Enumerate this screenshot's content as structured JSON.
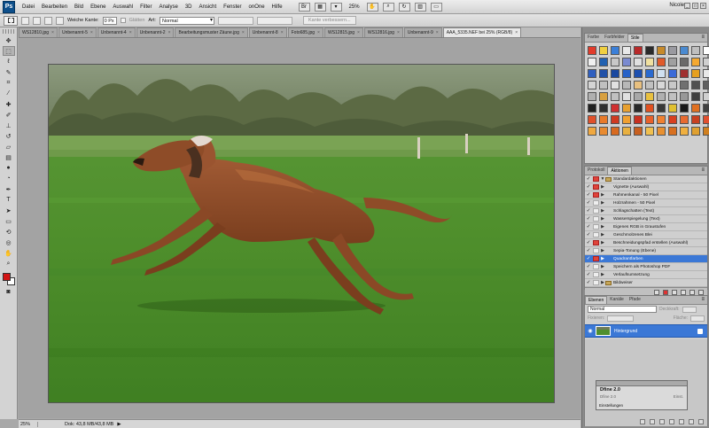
{
  "menubar": {
    "logo": "Ps",
    "items": [
      "Datei",
      "Bearbeiten",
      "Bild",
      "Ebene",
      "Auswahl",
      "Filter",
      "Analyse",
      "3D",
      "Ansicht",
      "Fenster",
      "onOne",
      "Hilfe"
    ],
    "zoom": "25%",
    "user": "Nicole"
  },
  "options": {
    "soft_edge_label": "Weiche Kante:",
    "soft_edge_value": "0 Px",
    "smooth_label": "Glätten",
    "style_label": "Art:",
    "style_value": "Normal",
    "refine_button": "Kante verbessern..."
  },
  "tabs": [
    {
      "label": "WS12810.jpg",
      "active": false
    },
    {
      "label": "Unbenannt-5",
      "active": false
    },
    {
      "label": "Unbenannt-4",
      "active": false
    },
    {
      "label": "Unbenannt-2",
      "active": false
    },
    {
      "label": "Bearbeitungsmuster Zäune.jpg",
      "active": false
    },
    {
      "label": "Unbenannt-8",
      "active": false
    },
    {
      "label": "Foto685.jpg",
      "active": false
    },
    {
      "label": "WS12815.jpg",
      "active": false
    },
    {
      "label": "WS12816.jpg",
      "active": false
    },
    {
      "label": "Unbenannt-9",
      "active": false
    },
    {
      "label": "AAA_5335.NEF bei 25% (RGB/8)",
      "active": true
    }
  ],
  "status": {
    "zoom": "25%",
    "doc": "Dok: 43,8 MB/43,8 MB"
  },
  "styles_panel": {
    "tabs": [
      "Farbe",
      "Farbfelder",
      "Stile"
    ],
    "active_tab": "Stile",
    "swatches": [
      "#e23b2a",
      "#f0d040",
      "#3a7fd8",
      "#e8e8e8",
      "#b92a2a",
      "#2a2a2a",
      "#c78a2a",
      "#9a9aa0",
      "#4a8ad0",
      "#bfbfbf",
      "#ffffff",
      "#f0f0f0",
      "#2060b0",
      "#c8c8c8",
      "#7a8ad0",
      "#e0e0e0",
      "#f0e0a0",
      "#e05a2a",
      "#a0a0a0",
      "#6a6a6a",
      "#f4a830",
      "#d0d0d0",
      "#3060c0",
      "#2050a8",
      "#1a48a0",
      "#2862c8",
      "#1e50b0",
      "#2a6ad0",
      "#d0e0f0",
      "#3a6ad8",
      "#a03030",
      "#e6a020",
      "#e8e8e8",
      "#d4d4d4",
      "#c0c0c0",
      "#e0e0e0",
      "#b8b8b8",
      "#e8c080",
      "#c0c0c0",
      "#d8d8d8",
      "#c8c8c8",
      "#707070",
      "#505050",
      "#606060",
      "#b0b0b0",
      "#d8a040",
      "#c0c0c0",
      "#e0e0e0",
      "#a8a8a8",
      "#e8c040",
      "#b0b0b0",
      "#c0c0c0",
      "#989898",
      "#404040",
      "#d0d0d0",
      "#202020",
      "#303030",
      "#d03030",
      "#e8a030",
      "#282828",
      "#e05020",
      "#383838",
      "#e0c030",
      "#181818",
      "#e07020",
      "#404040",
      "#e0502a",
      "#e87a2a",
      "#d03a20",
      "#f0a030",
      "#c83020",
      "#e8602a",
      "#f08030",
      "#d84020",
      "#e86a30",
      "#c84020",
      "#e05030",
      "#f0a840",
      "#e88a30",
      "#d86a20",
      "#e8b040",
      "#c86020",
      "#f0c050",
      "#e89030",
      "#d87020",
      "#f0b040",
      "#e0a030",
      "#d08020"
    ]
  },
  "actions_panel": {
    "tabs": [
      "Protokoll",
      "Aktionen"
    ],
    "active_tab": "Aktionen",
    "items": [
      {
        "label": "Standardaktionen",
        "dialog": true,
        "folder": true,
        "expand": "▼",
        "selected": false
      },
      {
        "label": "Vignette (Auswahl)",
        "dialog": true,
        "folder": false,
        "expand": "▶",
        "selected": false
      },
      {
        "label": "Rahmenkanal - 50 Pixel",
        "dialog": true,
        "folder": false,
        "expand": "▶",
        "selected": false
      },
      {
        "label": "Holzrahmen - 50 Pixel",
        "dialog": false,
        "folder": false,
        "expand": "▶",
        "selected": false
      },
      {
        "label": "Schlagschatten (Text)",
        "dialog": false,
        "folder": false,
        "expand": "▶",
        "selected": false
      },
      {
        "label": "Wasserspiegelung (Text)",
        "dialog": false,
        "folder": false,
        "expand": "▶",
        "selected": false
      },
      {
        "label": "Eigenes RGB in Graustufen",
        "dialog": false,
        "folder": false,
        "expand": "▶",
        "selected": false
      },
      {
        "label": "Geschmolzenes Blei",
        "dialog": false,
        "folder": false,
        "expand": "▶",
        "selected": false
      },
      {
        "label": "Beschneidungspfad erstellen (Auswahl)",
        "dialog": true,
        "folder": false,
        "expand": "▶",
        "selected": false
      },
      {
        "label": "Sepia-Tonung (Ebene)",
        "dialog": false,
        "folder": false,
        "expand": "▶",
        "selected": false
      },
      {
        "label": "Quadrantfarben",
        "dialog": true,
        "folder": false,
        "expand": "▶",
        "selected": true
      },
      {
        "label": "Speichern als Photoshop PDF",
        "dialog": false,
        "folder": false,
        "expand": "▶",
        "selected": false
      },
      {
        "label": "Verlaufsumsetzung",
        "dialog": false,
        "folder": false,
        "expand": "▶",
        "selected": false
      },
      {
        "label": "Bildweiser",
        "dialog": false,
        "folder": true,
        "expand": "▶",
        "selected": false
      }
    ]
  },
  "layers_panel": {
    "tabs": [
      "Ebenen",
      "Kanäle",
      "Pfade"
    ],
    "active_tab": "Ebenen",
    "blend_mode": "Normal",
    "opacity_label": "Deckkraft:",
    "lock_label": "Fixieren:",
    "fill_label": "Fläche:",
    "layer_name": "Hintergrund"
  },
  "dfine": {
    "title": "Dfine 2.0",
    "sub_left": "Dfine 2.0",
    "sub_right": "Einst.",
    "settings": "Einstellungen"
  },
  "colors": {
    "foreground": "#d31414",
    "background": "#ffffff",
    "selection": "#3b78d6"
  }
}
